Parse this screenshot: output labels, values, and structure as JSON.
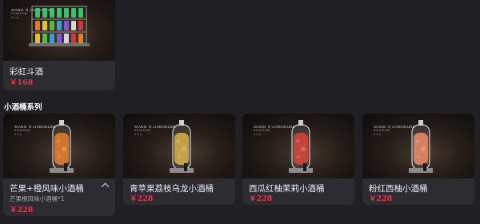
{
  "top_product": {
    "title": "彩虹斗酒",
    "price": "￥168"
  },
  "section": {
    "title": "小酒桶系列"
  },
  "brand": {
    "name": "XIANG 〣 LIVEHOUSE",
    "sub": "SHANGHAI",
    "line": "# # #"
  },
  "products": [
    {
      "title": "芒果+橙风味小酒桶",
      "price": "￥228",
      "desc": "芒果橙风味小酒桶*1",
      "expanded": true,
      "liquid": "#e8802a"
    },
    {
      "title": "青苹果荔枝乌龙小酒桶",
      "price": "￥228",
      "desc": "",
      "expanded": false,
      "liquid": "#d8b24a"
    },
    {
      "title": "西瓜红柚茉莉小酒桶",
      "price": "￥228",
      "desc": "",
      "expanded": false,
      "liquid": "#d8443a"
    },
    {
      "title": "粉红西柚小酒桶",
      "price": "￥228",
      "desc": "",
      "expanded": false,
      "liquid": "#ee8a68"
    }
  ],
  "icons": {
    "collapse": "chevron-up-icon"
  }
}
